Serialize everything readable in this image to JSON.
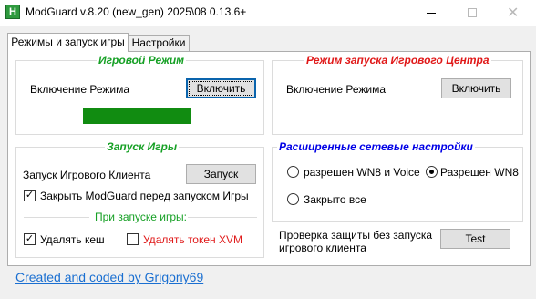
{
  "window": {
    "icon_letter": "H",
    "title": "ModGuard v.8.20 (new_gen) 2025\\08 0.13.6+",
    "minimize": "—",
    "close": "✕"
  },
  "tabs": [
    {
      "label": "Режимы и запуск игры",
      "active": true
    },
    {
      "label": "Настройки",
      "active": false
    }
  ],
  "game_mode": {
    "title": "Игровой Режим",
    "row_label": "Включение Режима",
    "button": "Включить",
    "status_color": "#118c11"
  },
  "game_center_mode": {
    "title": "Режим запуска Игрового Центра",
    "row_label": "Включение Режима",
    "button": "Включить"
  },
  "launch_game": {
    "title": "Запуск Игры",
    "client_label": "Запуск Игрового Клиента",
    "launch_button": "Запуск",
    "close_modguard": {
      "label": "Закрыть ModGuard перед запуском Игры",
      "checked": true
    },
    "on_launch_title": "При запуске игры:",
    "delete_cache": {
      "label": "Удалять кеш",
      "checked": true
    },
    "delete_token": {
      "label": "Удалять токен XVM",
      "checked": false
    }
  },
  "network": {
    "title": "Расширенные сетевые настройки",
    "options": [
      {
        "label": "разрешен WN8 и Voice",
        "selected": false
      },
      {
        "label": "Разрешен WN8",
        "selected": true
      },
      {
        "label": "Закрыто все",
        "selected": false
      }
    ]
  },
  "protection": {
    "label_line1": "Проверка защиты без запуска",
    "label_line2": "игрового клиента",
    "button": "Test"
  },
  "footer": {
    "link": "Created and coded by Grigoriy69"
  },
  "colors": {
    "group_green": "#16a025",
    "group_red": "#e01919",
    "group_blue": "#0000e6",
    "link": "#1a6fd1",
    "focus": "#0a64ad"
  }
}
